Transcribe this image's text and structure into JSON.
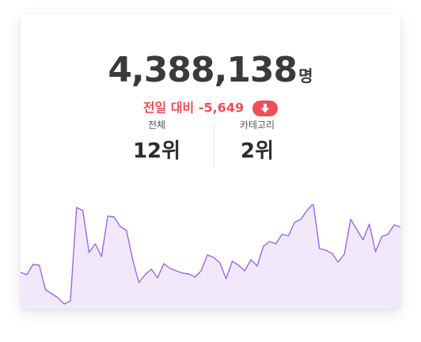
{
  "summary": {
    "total_value": "4,388,138",
    "total_unit": "명",
    "change_text": "전일 대비 -5,649",
    "change_color": "#ef4f57",
    "change_icon": "down-arrow-icon"
  },
  "ranks": [
    {
      "label": "전체",
      "value": "12위"
    },
    {
      "label": "카테고리",
      "value": "2위"
    }
  ],
  "chart_data": {
    "type": "area",
    "line_color": "#9966e6",
    "fill_color": "#f1e9fb",
    "values": [
      46,
      43,
      56,
      55,
      24,
      19,
      14,
      6,
      10,
      128,
      124,
      71,
      82,
      66,
      117,
      116,
      104,
      99,
      62,
      33,
      43,
      50,
      39,
      57,
      51,
      48,
      45,
      44,
      40,
      48,
      68,
      65,
      58,
      38,
      60,
      55,
      48,
      62,
      54,
      79,
      85,
      82,
      94,
      92,
      109,
      113,
      124,
      133,
      76,
      74,
      70,
      59,
      69,
      113,
      100,
      87,
      107,
      72,
      91,
      94,
      106,
      103
    ]
  }
}
